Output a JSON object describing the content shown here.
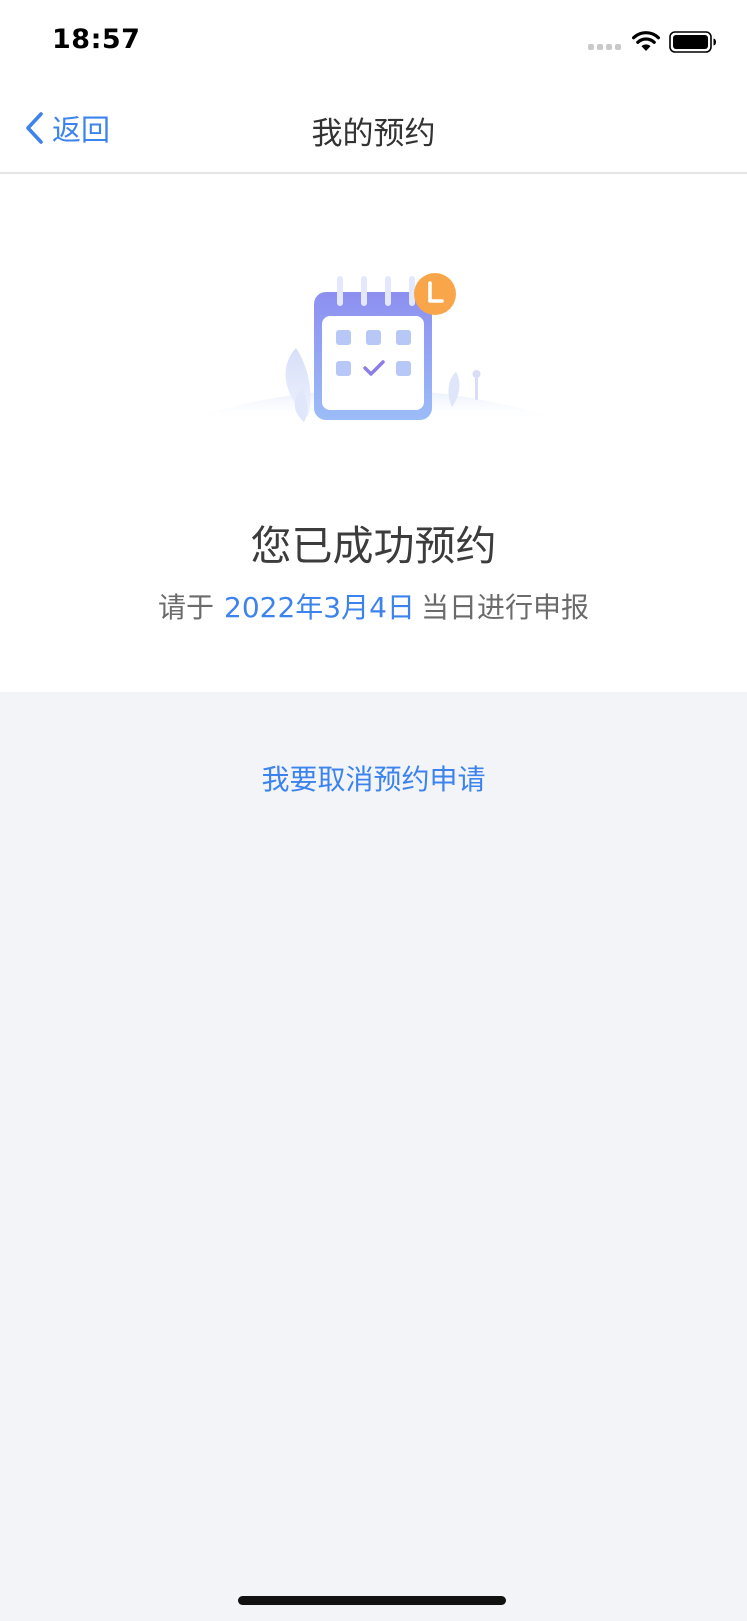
{
  "status_bar": {
    "time": "18:57"
  },
  "nav": {
    "back_label": "返回",
    "title": "我的预约"
  },
  "result": {
    "title": "您已成功预约",
    "prefix": "请于",
    "date": "2022年3月4日",
    "suffix": "当日进行申报"
  },
  "actions": {
    "cancel_label": "我要取消预约申请"
  },
  "colors": {
    "accent": "#3d83ee",
    "page_background": "#f2f4f8",
    "card_background": "#ffffff",
    "clock_badge": "#f9a64a",
    "calendar_gradient": "#8fa6f2"
  },
  "icons": {
    "back": "chevron-left-icon",
    "illustration": "calendar-clock-illustration",
    "wifi": "wifi-icon",
    "battery": "battery-icon"
  }
}
